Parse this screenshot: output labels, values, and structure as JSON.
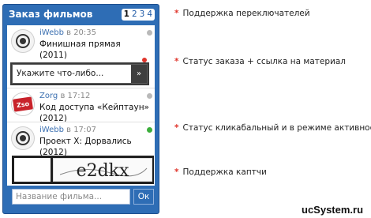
{
  "widget": {
    "title": "Заказ фильмов",
    "pages": [
      "1",
      "2",
      "3",
      "4"
    ],
    "active_page": "1",
    "orders": [
      {
        "author": "iWebb",
        "time": "в 20:35",
        "film": "Финишная прямая (2011)",
        "status": "inactive"
      },
      {
        "author": "Zorg",
        "time": "в 17:12",
        "film": "Код доступа «Кейптаун» (2012)",
        "status": "inactive"
      },
      {
        "author": "iWebb",
        "time": "в 17:07",
        "film": "Проект X: Дорвались (2012)",
        "status": "active"
      }
    ],
    "link_popup": {
      "placeholder": "Укажите что-либо...",
      "button": "»"
    },
    "captcha_text": "e2dkx",
    "search": {
      "placeholder": "Название фильма...",
      "button": "Ок"
    }
  },
  "notes": [
    "Поддержка переключателей",
    "Статус заказа + ссылка на материал",
    "Статус кликабальный и в режиме активности",
    "Поддержка каптчи"
  ],
  "zorg_logo": "Zso",
  "watermark": "ucSystem.ru",
  "colors": {
    "accent": "#2e6db5",
    "marker": "#e0342b",
    "status_active": "#3cae3c",
    "status_inactive": "#b9b9b9"
  }
}
